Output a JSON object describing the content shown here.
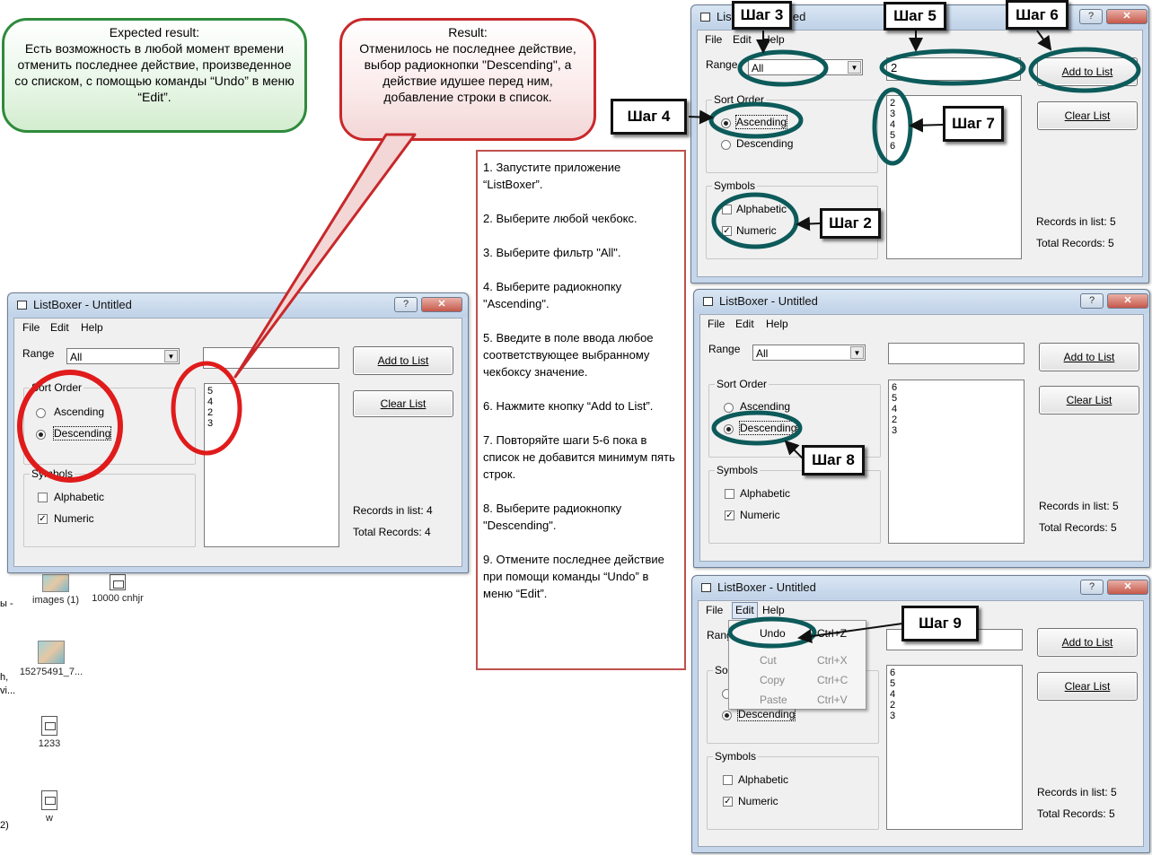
{
  "expected": {
    "title": "Expected result:",
    "text": "Есть возможность в любой момент времени отменить последнее действие, произведенное со списком, с помощью команды “Undo” в меню “Edit”."
  },
  "result": {
    "title": "Result:",
    "text": "Отменилось не последнее действие, выбор радиокнопки \"Descending\", а действие идушее перед ним, добавление строки в список."
  },
  "steps_list": [
    "1. Запустите приложение “ListBoxer”.",
    "2. Выберите любой чекбокс.",
    "3. Выберите фильтр \"All\".",
    "4. Выберите радиокнопку \"Ascending\".",
    "5. Введите в поле ввода любое соответствующее выбранному чекбоксу значение.",
    "6. Нажмите кнопку “Add to List”.",
    "7. Повторяйте шаги 5-6 пока в список не добавится минимум пять строк.",
    "8. Выберите радиокнопку \"Descending\".",
    "9. Отмените последнее действие при помощи команды “Undo” в меню “Edit”."
  ],
  "step_labels": {
    "s2": "Шаг 2",
    "s3": "Шаг 3",
    "s4": "Шаг 4",
    "s5": "Шаг 5",
    "s6": "Шаг 6",
    "s7": "Шаг 7",
    "s8": "Шаг 8",
    "s9": "Шаг 9"
  },
  "ui": {
    "title_full": "ListBoxer - Untitled",
    "title_partial": "List",
    "title_suffix_partial": "led",
    "help_btn": "?",
    "close_btn": "✕",
    "menu_file": "File",
    "menu_edit": "Edit",
    "menu_help": "Help",
    "range_label": "Range",
    "range_label_partial": "Rang",
    "range_value": "All",
    "add_to_list": "Add to List",
    "clear_list": "Clear List",
    "sort_order": "Sort Order",
    "sort_order_partial": "Sor",
    "ascending": "Ascending",
    "descending": "Descending",
    "symbols": "Symbols",
    "alphabetic": "Alphabetic",
    "numeric": "Numeric",
    "records_prefix": "Records in list: ",
    "total_prefix": "Total Records: "
  },
  "win_left": {
    "list": [
      "5",
      "4",
      "2",
      "3"
    ],
    "records": "Records in list: 4",
    "total": "Total Records: 4",
    "input": ""
  },
  "win_tr": {
    "list": [
      "2",
      "3",
      "4",
      "5",
      "6"
    ],
    "records": "Records in list: 5",
    "total": "Total Records: 5",
    "input": "2"
  },
  "win_mr": {
    "list": [
      "6",
      "5",
      "4",
      "2",
      "3"
    ],
    "records": "Records in list: 5",
    "total": "Total Records: 5",
    "input": ""
  },
  "win_br": {
    "list": [
      "6",
      "5",
      "4",
      "2",
      "3"
    ],
    "records": "Records in list: 5",
    "total": "Total Records: 5",
    "input": ""
  },
  "edit_menu": [
    {
      "name": "Undo",
      "shortcut": "Ctrl+Z",
      "enabled": true
    },
    {
      "name": "Cut",
      "shortcut": "Ctrl+X",
      "enabled": false
    },
    {
      "name": "Copy",
      "shortcut": "Ctrl+C",
      "enabled": false
    },
    {
      "name": "Paste",
      "shortcut": "Ctrl+V",
      "enabled": false
    }
  ],
  "desktop_icons": [
    {
      "label": "images (1)",
      "icon": "image-icon"
    },
    {
      "label": "10000 cnhjr",
      "icon": "document-icon"
    },
    {
      "label": "15275491_7...",
      "icon": "image-icon"
    },
    {
      "label": "1233",
      "icon": "document-icon"
    },
    {
      "label": "w",
      "icon": "document-icon"
    }
  ],
  "desktop_fragments": [
    "ы -",
    "h,",
    "vi...",
    "2)"
  ],
  "colors": {
    "annotation_teal": "#0d5a5a",
    "annotation_red": "#e01b1b",
    "bubble_green_border": "#2e8b3c",
    "bubble_red_border": "#c8282a",
    "steps_border": "#c0504d"
  }
}
